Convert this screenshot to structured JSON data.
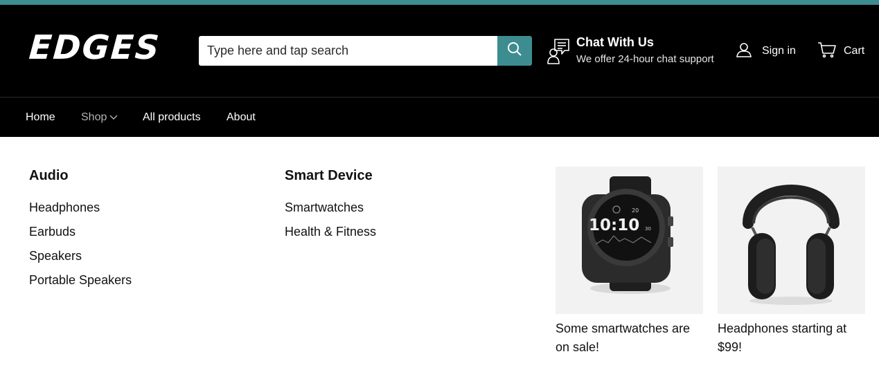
{
  "header": {
    "logo": "EDGES",
    "search": {
      "placeholder": "Type here and tap search",
      "value": ""
    },
    "chat": {
      "title": "Chat With Us",
      "subtitle": "We offer 24-hour chat support"
    },
    "signin_label": "Sign in",
    "cart_label": "Cart"
  },
  "nav": {
    "items": [
      {
        "label": "Home"
      },
      {
        "label": "Shop",
        "active": true
      },
      {
        "label": "All products"
      },
      {
        "label": "About"
      }
    ]
  },
  "menu": {
    "columns": [
      {
        "heading": "Audio",
        "links": [
          "Headphones",
          "Earbuds",
          "Speakers",
          "Portable Speakers"
        ]
      },
      {
        "heading": "Smart Device",
        "links": [
          "Smartwatches",
          "Health & Fitness"
        ]
      }
    ],
    "promos": [
      {
        "caption": "Some smartwatches are on sale!",
        "image": "smartwatch",
        "watch_time": "10:10",
        "watch_seconds": "30",
        "watch_top_number": "20"
      },
      {
        "caption": "Headphones starting at $99!",
        "image": "headphones"
      }
    ]
  },
  "colors": {
    "accent": "#3d8d90",
    "header_bg": "#000000",
    "nav_active": "#b3b3b3"
  },
  "icons": [
    "search-icon",
    "chat-icon",
    "user-icon",
    "cart-icon",
    "chevron-down-icon"
  ]
}
